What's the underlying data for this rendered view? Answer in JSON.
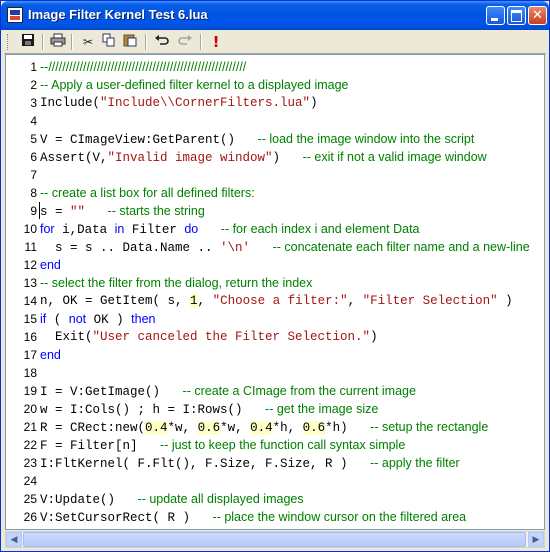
{
  "window": {
    "title": "Image Filter Kernel Test 6.lua"
  },
  "title_buttons": {
    "minimize": "minimize",
    "maximize": "maximize",
    "close": "close"
  },
  "toolbar": {
    "icons": [
      "save-icon",
      "print-icon",
      "cut-icon",
      "copy-icon",
      "paste-icon",
      "undo-icon",
      "redo-icon",
      "run-icon"
    ],
    "run_glyph": "!"
  },
  "editor": {
    "lines": [
      {
        "n": "1",
        "text": "--/////////////////////////////////////////////////////////"
      },
      {
        "n": "2",
        "text": "-- Apply a user-defined filter kernel to a displayed image"
      },
      {
        "n": "3",
        "text": "Include(\"Include\\\\CornerFilters.lua\")"
      },
      {
        "n": "4",
        "text": ""
      },
      {
        "n": "5",
        "a": "V = CImageView:GetParent()",
        "c": "-- load the image window into the script"
      },
      {
        "n": "6",
        "a": "Assert(V,\"Invalid image window\")",
        "c": "-- exit if not a valid image window"
      },
      {
        "n": "7",
        "text": ""
      },
      {
        "n": "8",
        "c": "-- create a list box for all defined filters:"
      },
      {
        "n": "9",
        "a": "s = \"\"",
        "c": "-- starts the string"
      },
      {
        "n": "10",
        "a": "for i,Data in Filter do",
        "c": "-- for each index i and element Data"
      },
      {
        "n": "11",
        "a": "  s = s .. Data.Name .. '\\n'",
        "c": "-- concatenate each filter name and a new-line"
      },
      {
        "n": "12",
        "a": "end"
      },
      {
        "n": "13",
        "c": "-- select the filter from the dialog, return the index"
      },
      {
        "n": "14",
        "a": "n, OK = GetItem( s, 1, \"Choose a filter:\", \"Filter Selection\" )"
      },
      {
        "n": "15",
        "a": "if ( not OK ) then"
      },
      {
        "n": "16",
        "a": "  Exit(\"User canceled the Filter Selection.\")"
      },
      {
        "n": "17",
        "a": "end"
      },
      {
        "n": "18",
        "text": ""
      },
      {
        "n": "19",
        "a": "I = V:GetImage()",
        "c": "-- create a CImage from the current image"
      },
      {
        "n": "20",
        "a": "w = I:Cols() ; h = I:Rows()",
        "c": "-- get the image size"
      },
      {
        "n": "21",
        "a": "R = CRect:new(0.4*w, 0.6*w, 0.4*h, 0.6*h)",
        "c": "-- setup the rectangle"
      },
      {
        "n": "22",
        "a": "F = Filter[n]",
        "c": "-- just to keep the function call syntax simple"
      },
      {
        "n": "23",
        "a": "I:FltKernel( F.Flt(), F.Size, F.Size, R )",
        "c": "-- apply the filter"
      },
      {
        "n": "24",
        "text": ""
      },
      {
        "n": "25",
        "a": "V:Update()",
        "c": "-- update all displayed images"
      },
      {
        "n": "26",
        "a": "V:SetCursorRect( R )",
        "c": "-- place the window cursor on the filtered area"
      }
    ]
  },
  "scrollbar": {
    "left_arrow": "◀",
    "right_arrow": "▶"
  }
}
